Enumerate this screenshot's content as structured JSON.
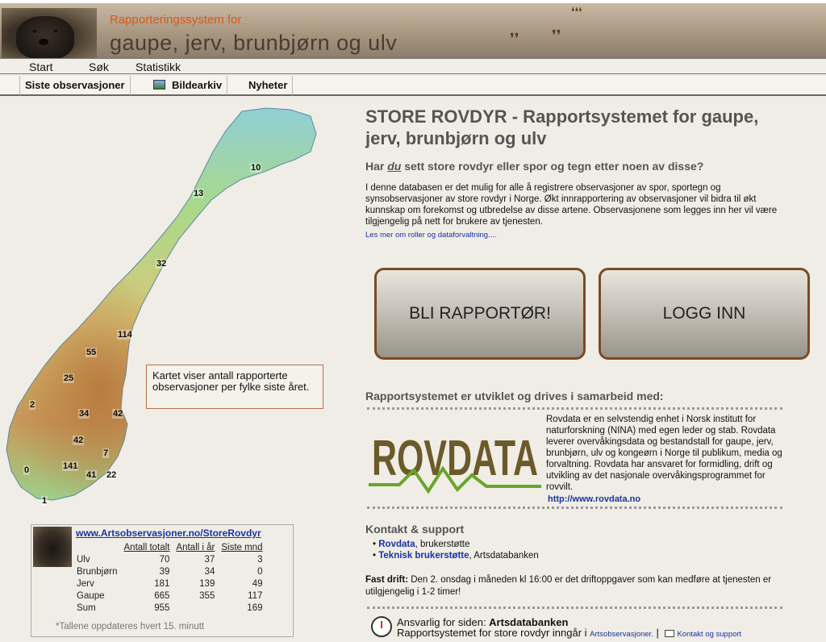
{
  "header": {
    "subtitle": "Rapporteringssystem for",
    "title": "gaupe, jerv, brunbjørn og ulv"
  },
  "menu_main": {
    "start": "Start",
    "search": "Søk",
    "statistics": "Statistikk"
  },
  "menu_sub": {
    "latest": "Siste observasjoner",
    "image_archive": "Bildearkiv",
    "news": "Nyheter"
  },
  "map": {
    "counts": [
      "10",
      "13",
      "32",
      "114",
      "55",
      "25",
      "2",
      "34",
      "42",
      "42",
      "7",
      "0",
      "141",
      "41",
      "22",
      "1"
    ],
    "note": "Kartet viser antall rapporterte observasjoner per fylke siste året."
  },
  "stats": {
    "link": "www.Artsobservasjoner.no/StoreRovdyr",
    "headers": [
      "Antall totalt",
      "Antall i år",
      "Siste mnd"
    ],
    "rows": [
      {
        "name": "Ulv",
        "total": "70",
        "year": "37",
        "month": "3"
      },
      {
        "name": "Brunbjørn",
        "total": "39",
        "year": "34",
        "month": "0"
      },
      {
        "name": "Jerv",
        "total": "181",
        "year": "139",
        "month": "49"
      },
      {
        "name": "Gaupe",
        "total": "665",
        "year": "355",
        "month": "117"
      },
      {
        "name": "Sum",
        "total": "955",
        "year": "",
        "month": "169"
      }
    ],
    "footnote": "Tallene oppdateres hvert 15. minutt"
  },
  "main": {
    "heading": "STORE ROVDYR - Rapportsystemet for gaupe, jerv, brunbjørn og ulv",
    "question_pre": "Har ",
    "question_em": "du",
    "question_post": " sett store rovdyr eller spor og tegn etter noen av disse?",
    "intro": "I denne databasen er det mulig for alle å registrere observasjoner av spor, sportegn og synsobservasjoner av store rovdyr i Norge. Økt innrapportering av observasjoner vil bidra til økt kunnskap om forekomst og utbredelse av disse artene. Observasjonene som legges inn her vil være tilgjengelig på nett for brukere av tjenesten.",
    "more_link": "Les mer om roller og dataforvaltning....",
    "btn_register": "BLI RAPPORTØR!",
    "btn_login": "LOGG INN",
    "partner_heading": "Rapportsystemet er utviklet og drives i samarbeid med:",
    "rovdata_logo": "ROVDATA",
    "rovdata_text": "Rovdata er en selvstendig enhet i Norsk institutt for naturforskning (NINA) med egen leder og stab. Rovdata leverer overvåkingsdata og bestandstall for gaupe, jerv, brunbjørn, ulv og kongeørn i Norge til publikum, media og forvaltning. Rovdata har ansvaret for formidling, drift og utvikling av det nasjonale overvåkingsprogrammet for rovvilt.",
    "rovdata_link": "http://www.rovdata.no",
    "contact_heading": "Kontakt & support",
    "contact1_link": "Rovdata",
    "contact1_text": ", brukerstøtte",
    "contact2_link": "Teknisk brukerstøtte",
    "contact2_text": ", Artsdatabanken",
    "drift_label": "Fast drift:",
    "drift_text": " Den 2. onsdag i måneden kl 16:00 er det driftoppgaver som kan medføre at tjenesten er utilgjengelig i 1-2 timer!",
    "resp_pre": "Ansvarlig for siden: ",
    "resp_org": "Artsdatabanken",
    "resp2_text": "Rapportsystemet for store rovdyr inngår i ",
    "resp2_link": "Artsobservasjoner.",
    "resp2_sep": " | ",
    "resp2_contact": "Kontakt og support"
  },
  "colors": {
    "accent_orange": "#d65a1c",
    "button_border": "#7a4a24",
    "link": "#1a33a3",
    "rovdata_brown": "#6b5a2a",
    "rovdata_green": "#6aa52a"
  }
}
